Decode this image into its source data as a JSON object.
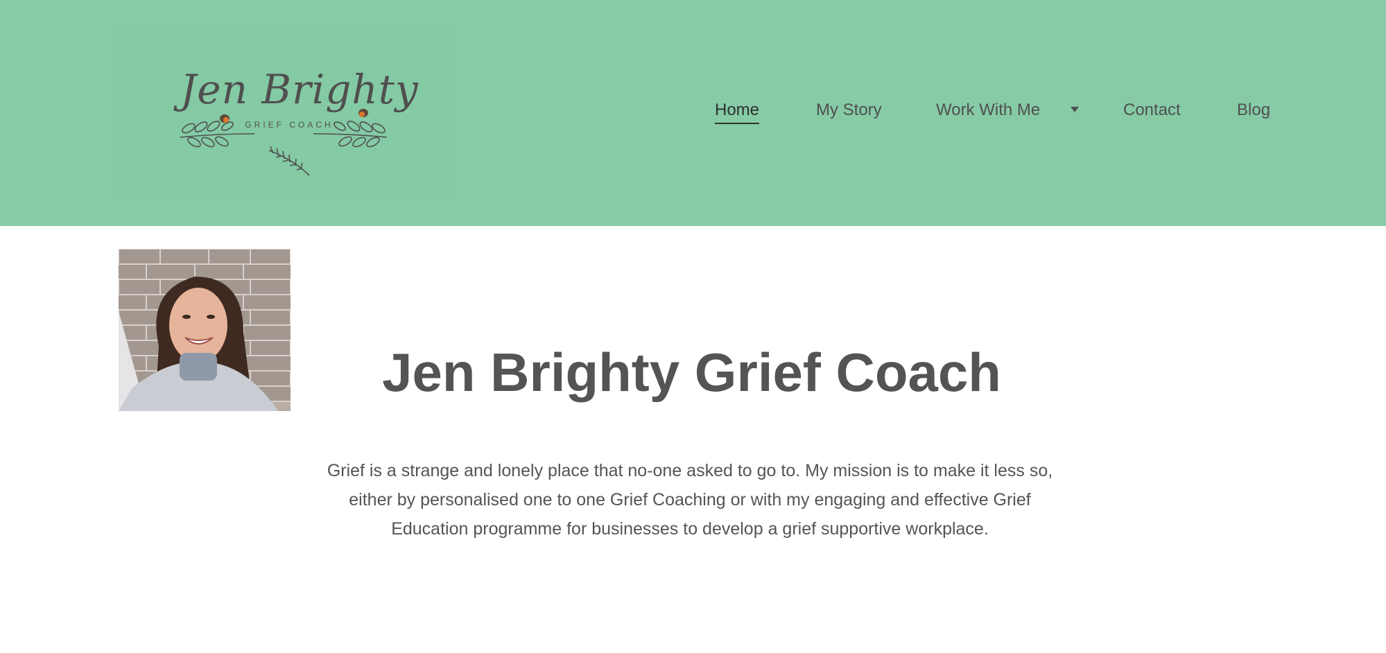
{
  "brand": {
    "logo_script": "Jen Brighty",
    "logo_subtitle": "GRIEF COACH"
  },
  "nav": {
    "items": [
      {
        "label": "Home",
        "active": true
      },
      {
        "label": "My Story"
      },
      {
        "label": "Work With Me",
        "has_dropdown": true
      },
      {
        "label": "Contact"
      },
      {
        "label": "Blog"
      }
    ]
  },
  "hero": {
    "title": "Jen Brighty Grief Coach",
    "intro_lines": [
      "Grief is a strange and lonely place that no-one asked to go to. My mission is to make it less so,",
      "either by personalised one to one Grief Coaching or with my engaging and effective Grief",
      "Education programme for businesses to develop a grief supportive workplace."
    ]
  },
  "colors": {
    "header_bg": "#86cba6",
    "text": "#545454",
    "robin_orange": "#d9782f"
  },
  "icons": {
    "dropdown": "caret-down-icon",
    "feather": "feather-icon",
    "bird": "robin-icon"
  }
}
